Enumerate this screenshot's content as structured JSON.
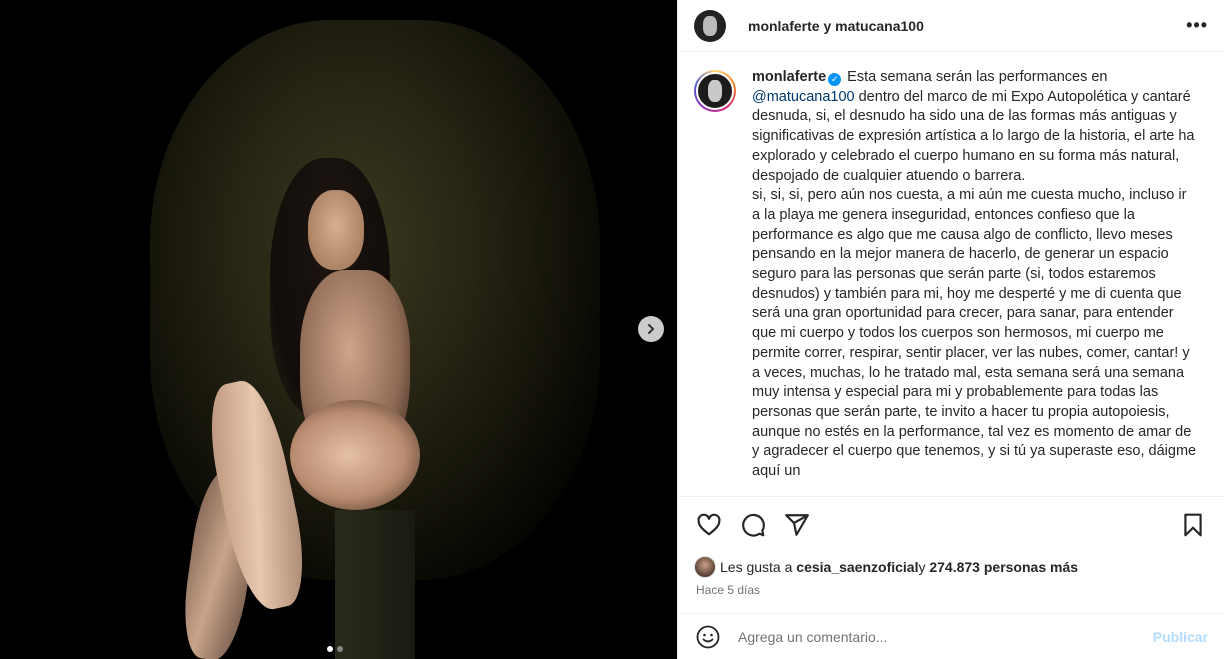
{
  "media": {
    "next_icon": "chevron-right-icon",
    "carousel_count": 2,
    "carousel_active": 1
  },
  "header": {
    "title": "monlaferte y matucana100",
    "more_icon": "more-horizontal-icon",
    "more_label": "•••"
  },
  "caption": {
    "username": "monlaferte",
    "verified_icon": "verified-badge-icon",
    "text_1_pre": "Esta semana serán las performances en ",
    "mention": "@matucana100",
    "text_1_post": " dentro del marco de mi Expo Autopolética y cantaré desnuda, si, el desnudo ha sido una de las formas más antiguas y significativas de expresión artística a lo largo de la historia, el arte ha explorado y celebrado el cuerpo humano en su forma más natural, despojado de cualquier atuendo o barrera.",
    "text_2": "si, si, si, pero aún nos cuesta, a mi aún me cuesta mucho, incluso ir a la playa me genera inseguridad, entonces confieso que la performance es algo que me causa algo de conflicto, llevo meses pensando en la mejor manera de hacerlo, de generar un espacio seguro para las personas que serán parte (si, todos estaremos desnudos) y también para mi, hoy me desperté y me di cuenta que será una gran oportunidad para crecer, para sanar, para entender que mi cuerpo y todos los cuerpos son hermosos, mi cuerpo me permite correr, respirar, sentir placer, ver las nubes, comer, cantar! y a veces, muchas, lo he tratado mal, esta semana será una semana muy intensa y especial para mi y probablemente para todas las personas que serán parte, te invito a hacer tu propia autopoiesis, aunque no estés en la performance, tal vez es momento de amar de y agradecer el cuerpo que tenemos, y si tú ya superaste eso, dáigme aquí un"
  },
  "actions": {
    "like_icon": "heart-icon",
    "comment_icon": "comment-icon",
    "share_icon": "send-icon",
    "save_icon": "bookmark-icon"
  },
  "likes": {
    "prefix": "Les gusta a ",
    "user": "cesia_saenzoficial",
    "middle": " y ",
    "count": "274.873 personas más"
  },
  "time": "Hace 5 días",
  "comment": {
    "emoji_icon": "emoji-icon",
    "placeholder": "Agrega un comentario...",
    "post_label": "Publicar"
  },
  "colors": {
    "link": "#00376b",
    "verified": "#0095f6",
    "post_disabled": "#b3dbff",
    "muted": "#737373"
  }
}
